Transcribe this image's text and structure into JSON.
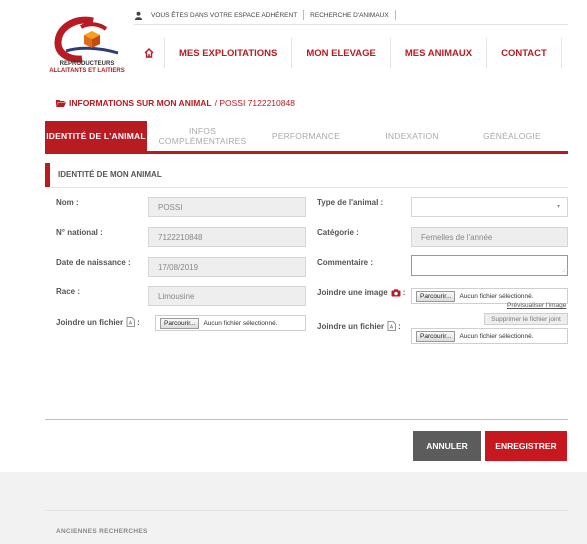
{
  "header": {
    "logo_line1": "REPRODUCTEURS",
    "logo_line2": "ALLAITANTS ET LAITIERS",
    "topbar": {
      "account_text": "VOUS ÊTES DANS VOTRE ESPACE ADHÉRENT",
      "search_text": "RECHERCHE D'ANIMAUX"
    },
    "nav": [
      "MES EXPLOITATIONS",
      "MON ELEVAGE",
      "MES ANIMAUX",
      "CONTACT"
    ]
  },
  "breadcrumb": {
    "title": "INFORMATIONS SUR MON ANIMAL",
    "current": "/ POSSI 7122210848"
  },
  "tabs": [
    {
      "label": "IDENTITÉ DE L'ANIMAL"
    },
    {
      "label_line1": "INFOS",
      "label_line2": "COMPLÉMENTAIRES"
    },
    {
      "label": "PERFORMANCE"
    },
    {
      "label": "INDEXATION"
    },
    {
      "label": "GÉNÉALOGIE"
    }
  ],
  "section_title": "IDENTITÉ DE MON ANIMAL",
  "form": {
    "nom_label": "Nom :",
    "nom_value": "POSSI",
    "national_label": "N° national :",
    "national_value": "7122210848",
    "naissance_label": "Date de naissance :",
    "naissance_value": "17/08/2019",
    "race_label": "Race :",
    "race_value": "Limousine",
    "fichier_left_label": "Joindre un fichier",
    "type_label": "Type de l'animal :",
    "type_value": "",
    "categorie_label": "Catégorie :",
    "categorie_value": "Femelles de l'année",
    "commentaire_label": "Commentaire :",
    "commentaire_value": "",
    "image_label": "Joindre une image",
    "fichier_right_label": "Joindre un fichier",
    "browse_label": "Parcourir...",
    "no_file_text": "Aucun fichier sélectionné.",
    "preview_link": "Prévisualiser l'image",
    "delete_file_button": "Supprimer le fichier joint"
  },
  "buttons": {
    "cancel": "ANNULER",
    "save": "ENREGISTRER"
  },
  "footer": {
    "old_searches": "ANCIENNES RECHERCHES"
  },
  "colors": {
    "brand_red": "#b81b22",
    "cancel_grey": "#5c5c5c"
  }
}
